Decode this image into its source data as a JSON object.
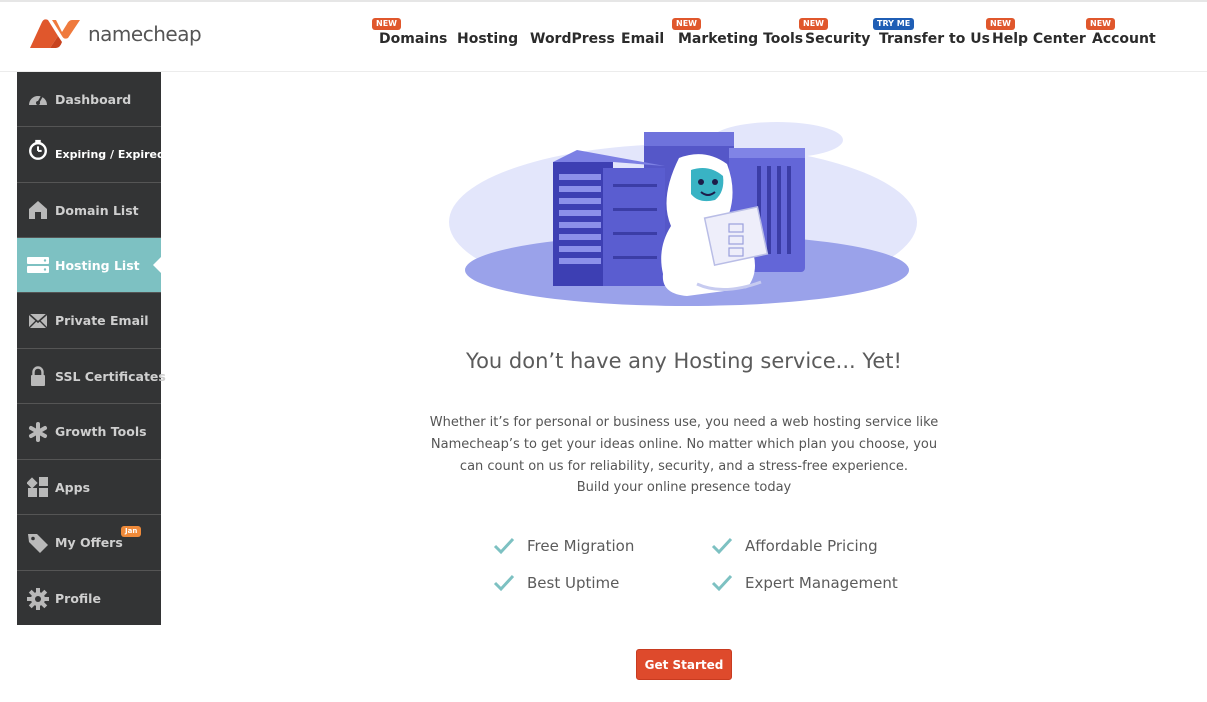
{
  "brand": {
    "name": "namecheap",
    "color": "#e0572c"
  },
  "nav": [
    {
      "label": "Domains",
      "badge": "NEW",
      "badge_color": "#e0572c"
    },
    {
      "label": "Hosting",
      "badge": ""
    },
    {
      "label": "WordPress",
      "badge": ""
    },
    {
      "label": "Email",
      "badge": ""
    },
    {
      "label": "Marketing Tools",
      "badge": "NEW",
      "badge_color": "#e0572c"
    },
    {
      "label": "Security",
      "badge": "NEW",
      "badge_color": "#e0572c"
    },
    {
      "label": "Transfer to Us",
      "badge": "TRY ME",
      "badge_color": "#1f5eb5"
    },
    {
      "label": "Help Center",
      "badge": "NEW",
      "badge_color": "#e0572c"
    },
    {
      "label": "Account",
      "badge": "NEW",
      "badge_color": "#e0572c"
    }
  ],
  "sidebar": {
    "active_index": 3,
    "items": [
      {
        "label": "Dashboard",
        "icon": "gauge-icon"
      },
      {
        "label": "Expiring / Expired",
        "icon": "timer-icon"
      },
      {
        "label": "Domain List",
        "icon": "house-icon"
      },
      {
        "label": "Hosting List",
        "icon": "server-icon"
      },
      {
        "label": "Private Email",
        "icon": "envelope-icon"
      },
      {
        "label": "SSL Certificates",
        "icon": "lock-icon"
      },
      {
        "label": "Growth Tools",
        "icon": "asterisk-icon"
      },
      {
        "label": "Apps",
        "icon": "apps-grid-icon"
      },
      {
        "label": "My Offers",
        "icon": "tag-icon",
        "badge": "Jan"
      },
      {
        "label": "Profile",
        "icon": "gear-icon"
      }
    ],
    "active_color": "#7dc1c2"
  },
  "main": {
    "headline": "You don’t have any Hosting service... Yet!",
    "description_lines": [
      "Whether it’s for personal or business use, you need a web hosting service like",
      "Namecheap’s to get your ideas online. No matter which plan you choose, you",
      "can count on us for reliability, security, and a stress-free experience.",
      "Build your online presence today"
    ],
    "features": [
      "Free Migration",
      "Affordable Pricing",
      "Best Uptime",
      "Expert Management"
    ],
    "check_color": "#7dc1c2",
    "cta_label": "Get Started",
    "cta_color": "#de4a2c"
  }
}
